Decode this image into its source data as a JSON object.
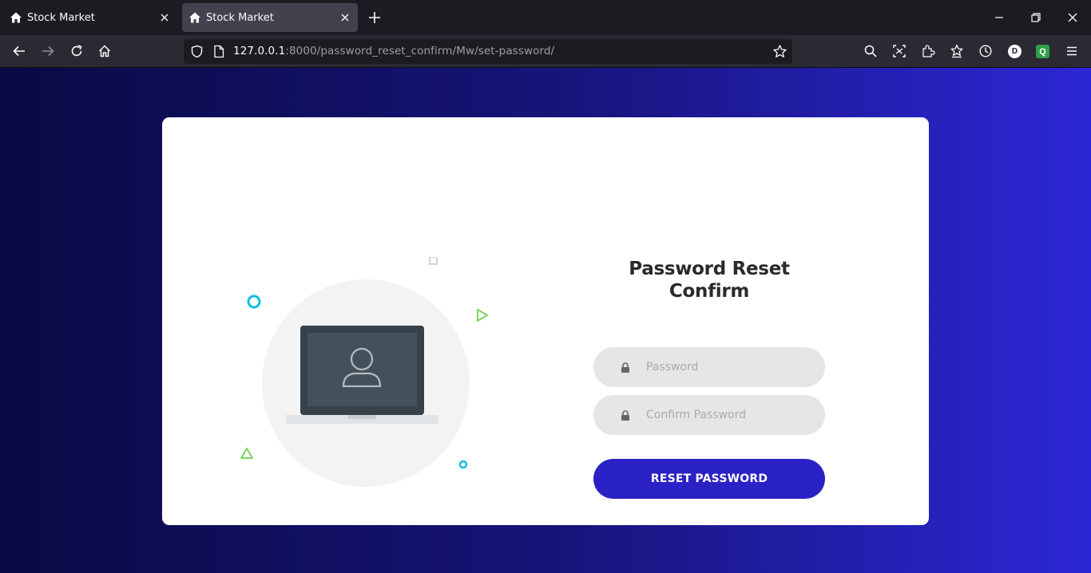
{
  "browser": {
    "tabs": [
      {
        "title": "Stock Market",
        "favicon": "home-icon",
        "active": false
      },
      {
        "title": "Stock Market",
        "favicon": "home-icon",
        "active": true
      }
    ],
    "url": {
      "host": "127.0.0.1",
      "rest": ":8000/password_reset_confirm/Mw/set-password/"
    },
    "profile_initial": "D",
    "extension_initial": "Q",
    "colors": {
      "tabbar": "#1c1b22",
      "toolbar": "#2b2a33",
      "urlbar": "#1c1b22"
    }
  },
  "page": {
    "title_line1": "Password Reset",
    "title_line2": "Confirm",
    "password_placeholder": "Password",
    "confirm_placeholder": "Confirm Password",
    "submit_label": "RESET PASSWORD",
    "colors": {
      "accent": "#2a22c5",
      "bg_left": "#0a0a44",
      "bg_right": "#2c27d6",
      "input_bg": "#e6e6e6",
      "deco_cyan": "#12bde0",
      "deco_green": "#7cd35c"
    }
  }
}
